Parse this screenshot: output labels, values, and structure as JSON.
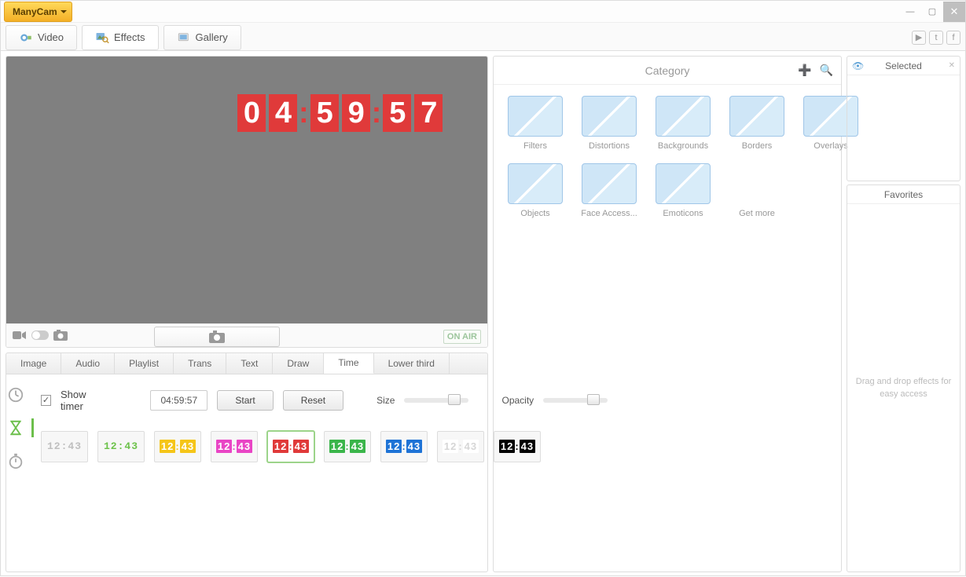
{
  "app": {
    "name": "ManyCam"
  },
  "window": {
    "minimize": "minimize",
    "maximize": "maximize",
    "close": "close"
  },
  "main_tabs": [
    {
      "id": "video",
      "label": "Video",
      "active": false
    },
    {
      "id": "effects",
      "label": "Effects",
      "active": true
    },
    {
      "id": "gallery",
      "label": "Gallery",
      "active": false
    }
  ],
  "social": {
    "yt": "youtube-icon",
    "tw": "twitter-icon",
    "fb": "facebook-icon"
  },
  "preview": {
    "timer_display": "04:59:57",
    "digits": [
      "0",
      "4",
      "5",
      "9",
      "5",
      "7"
    ],
    "onair": "ON AIR",
    "icons": {
      "camcorder": "camcorder-icon",
      "toggle": "toggle-icon",
      "photo": "photo-icon"
    }
  },
  "sub_tabs": [
    "Image",
    "Audio",
    "Playlist",
    "Trans",
    "Text",
    "Draw",
    "Time",
    "Lower third"
  ],
  "sub_tab_active": "Time",
  "time_side_icons": [
    {
      "id": "clock",
      "name": "clock-icon"
    },
    {
      "id": "hourglass",
      "name": "hourglass-icon",
      "active": true
    },
    {
      "id": "stopwatch",
      "name": "stopwatch-icon"
    }
  ],
  "timer_controls": {
    "show_timer_label": "Show timer",
    "show_timer_checked": true,
    "time_value": "04:59:57",
    "start_label": "Start",
    "reset_label": "Reset",
    "size_label": "Size",
    "opacity_label": "Opacity"
  },
  "timer_styles": [
    {
      "id": "thin-grey",
      "fg": "#bfbfbf",
      "bg": "transparent",
      "mono": true
    },
    {
      "id": "thin-green",
      "fg": "#6cc24a",
      "bg": "transparent",
      "mono": true
    },
    {
      "id": "block-yellow",
      "fg": "#ffffff",
      "bg": "#f5c518"
    },
    {
      "id": "block-pink",
      "fg": "#ffffff",
      "bg": "#e945c5"
    },
    {
      "id": "block-red",
      "fg": "#ffffff",
      "bg": "#e03a3a",
      "selected": true
    },
    {
      "id": "block-green",
      "fg": "#ffffff",
      "bg": "#3ab54a"
    },
    {
      "id": "block-blue",
      "fg": "#ffffff",
      "bg": "#1e73d6"
    },
    {
      "id": "block-white",
      "fg": "#d6d6d6",
      "bg": "#ffffff"
    },
    {
      "id": "block-black",
      "fg": "#ffffff",
      "bg": "#000000"
    }
  ],
  "timer_style_sample": "12:43",
  "categories_title": "Category",
  "categories": [
    {
      "id": "filters",
      "label": "Filters"
    },
    {
      "id": "distortions",
      "label": "Distortions"
    },
    {
      "id": "backgrounds",
      "label": "Backgrounds"
    },
    {
      "id": "borders",
      "label": "Borders"
    },
    {
      "id": "overlays",
      "label": "Overlays"
    },
    {
      "id": "objects",
      "label": "Objects"
    },
    {
      "id": "face",
      "label": "Face Access..."
    },
    {
      "id": "emoticons",
      "label": "Emoticons"
    },
    {
      "id": "getmore",
      "label": "Get more",
      "getmore": true
    }
  ],
  "right_panel": {
    "selected_title": "Selected",
    "favorites_title": "Favorites",
    "favorites_hint": "Drag and drop effects for easy access"
  }
}
